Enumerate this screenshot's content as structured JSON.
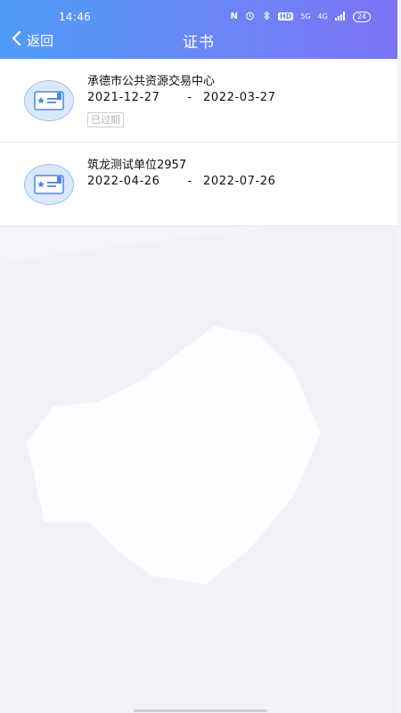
{
  "status_bar": {
    "time": "14:46",
    "icons": [
      "N",
      "alarm-icon",
      "bluetooth-icon",
      "HD",
      "5G",
      "4G",
      "signal-icon"
    ],
    "hd_label": "HD",
    "net1_label": "5G",
    "net2_label": "4G",
    "battery": "24"
  },
  "nav": {
    "back_label": "返回",
    "title": "证书"
  },
  "certificates": [
    {
      "name": "承德市公共资源交易中心",
      "start_date": "2021-12-27",
      "separator": "-",
      "end_date": "2022-03-27",
      "badge": "已过期"
    },
    {
      "name": "筑龙测试单位2957",
      "start_date": "2022-04-26",
      "separator": "-",
      "end_date": "2022-07-26",
      "badge": ""
    }
  ],
  "colors": {
    "header_gradient_start": "#4f9cf7",
    "header_gradient_end": "#7b73f4",
    "icon_bg": "#dbe8fb",
    "icon_accent": "#4a86e8",
    "badge_text": "#b4b4b4"
  }
}
